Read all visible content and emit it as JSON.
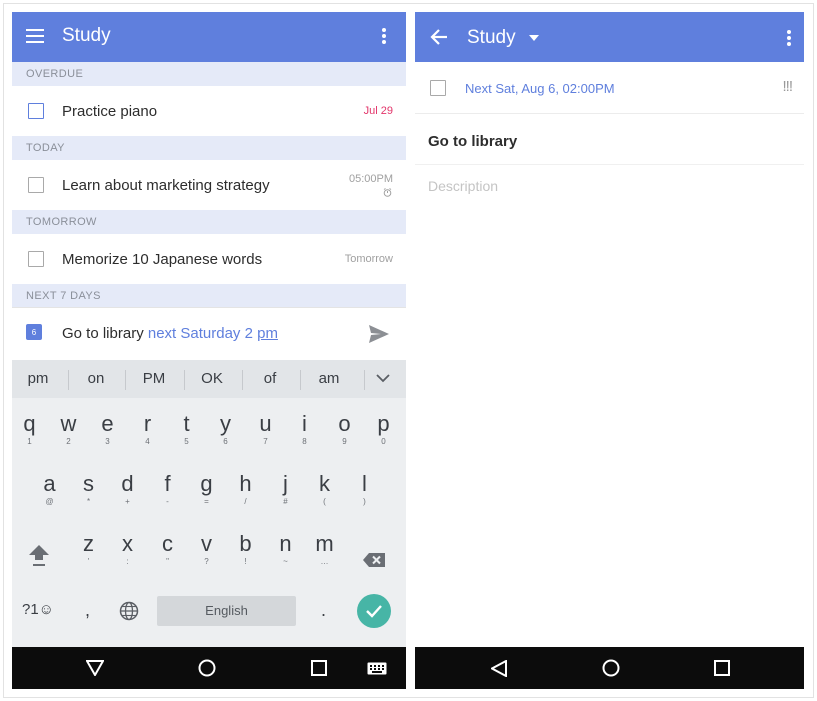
{
  "left": {
    "title": "Study",
    "sections": {
      "overdue": "OVERDUE",
      "today": "TODAY",
      "tomorrow": "TOMORROW",
      "next7": "NEXT 7 DAYS"
    },
    "tasks": [
      {
        "label": "Practice piano",
        "date": "Jul 29",
        "date_color": "#e2356a"
      },
      {
        "label": "Learn about marketing strategy",
        "date": "05:00PM"
      },
      {
        "label": "Memorize 10 Japanese words",
        "date": "Tomorrow"
      }
    ],
    "quick_add": {
      "calendar_day": "6",
      "text": "Go to library",
      "parsed": "next Saturday 2",
      "parsed_tail": "pm"
    },
    "suggestions": [
      "pm",
      "on",
      "PM",
      "OK",
      "of",
      "am"
    ],
    "keyboard": {
      "row1": [
        [
          "q",
          "1"
        ],
        [
          "w",
          "2"
        ],
        [
          "e",
          "3"
        ],
        [
          "r",
          "4"
        ],
        [
          "t",
          "5"
        ],
        [
          "y",
          "6"
        ],
        [
          "u",
          "7"
        ],
        [
          "i",
          "8"
        ],
        [
          "o",
          "9"
        ],
        [
          "p",
          "0"
        ]
      ],
      "row2": [
        [
          "a",
          "@"
        ],
        [
          "s",
          "*"
        ],
        [
          "d",
          "+"
        ],
        [
          "f",
          "-"
        ],
        [
          "g",
          "="
        ],
        [
          "h",
          "/"
        ],
        [
          "j",
          "#"
        ],
        [
          "k",
          "("
        ],
        [
          "l",
          ")"
        ]
      ],
      "row3": [
        [
          "z",
          "'"
        ],
        [
          "x",
          ":"
        ],
        [
          "c",
          "\""
        ],
        [
          "v",
          "?"
        ],
        [
          "b",
          "!"
        ],
        [
          "n",
          "~"
        ],
        [
          "m",
          "…"
        ]
      ],
      "symbols_label": "?1☺",
      "comma": ",",
      "space_label": "English",
      "period": "."
    }
  },
  "right": {
    "title": "Study",
    "date_text": "Next Sat, Aug 6, 02:00PM",
    "priority": "!!!",
    "task_title": "Go to library",
    "description_placeholder": "Description"
  },
  "colors": {
    "accent": "#5f7fdd",
    "overdue": "#e2356a",
    "done_button": "#47b5a6",
    "section_bg": "#e5eaf8"
  }
}
